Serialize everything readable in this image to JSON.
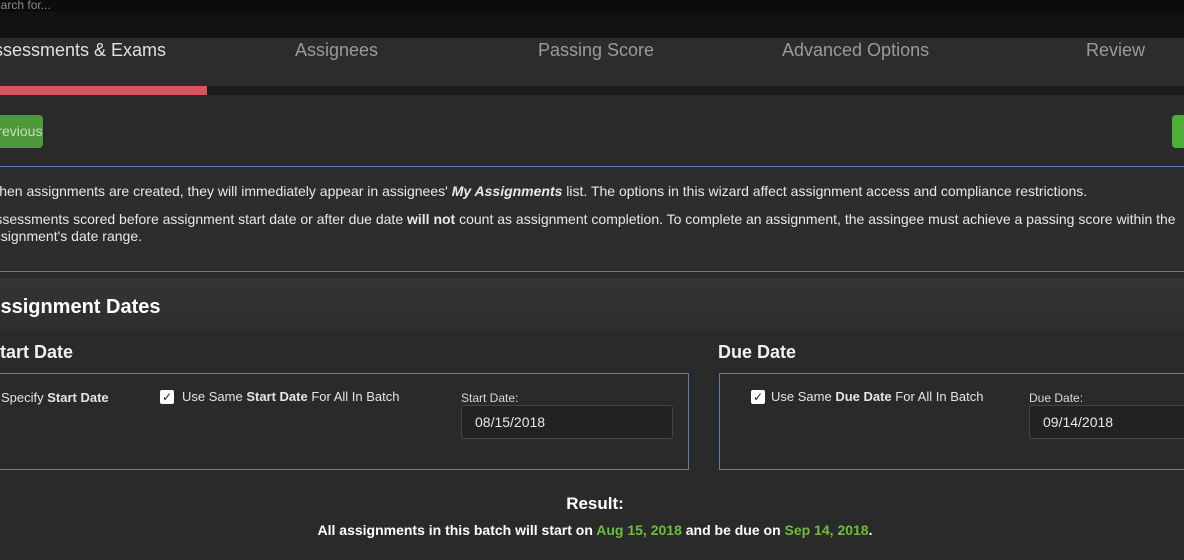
{
  "search": {
    "placeholder": "Search for..."
  },
  "wizard": {
    "tabs": [
      {
        "label": "Assessments & Exams"
      },
      {
        "label": "Assignees"
      },
      {
        "label": "Passing Score"
      },
      {
        "label": "Advanced Options"
      },
      {
        "label": "Review"
      }
    ],
    "progress_fraction": 0.175,
    "progress_color": "#d9535c"
  },
  "nav": {
    "previous_label": "Previous"
  },
  "info": {
    "line1_pre": "When assignments are created, they will immediately appear in assignees' ",
    "line1_em": "My Assignments",
    "line1_post": " list. The options in this wizard affect assignment access and compliance restrictions.",
    "line2_pre": "Assessments scored before assignment start date or after due date ",
    "line2_bold": "will not",
    "line2_post": " count as assignment completion. To complete an assignment, the assingee must achieve a passing score within the",
    "line3": "assignment's date range."
  },
  "section": {
    "title": "Assignment Dates"
  },
  "start": {
    "title": "Start Date",
    "specify_pre": "Specify ",
    "specify_bold": "Start Date",
    "same_pre": "Use Same ",
    "same_bold": "Start Date",
    "same_post": " For All In Batch",
    "same_checked": true,
    "field_label": "Start Date:",
    "value": "08/15/2018"
  },
  "due": {
    "title": "Due Date",
    "same_pre": "Use Same ",
    "same_bold": "Due Date",
    "same_post": " For All In Batch",
    "same_checked": true,
    "field_label": "Due Date:",
    "value": "09/14/2018"
  },
  "result": {
    "title": "Result:",
    "pre": "All assignments in this batch will start on ",
    "start": "Aug 15, 2018",
    "mid": " and be due on ",
    "due": "Sep 14, 2018",
    "post": ".",
    "highlight_color": "#6cbf3a"
  }
}
